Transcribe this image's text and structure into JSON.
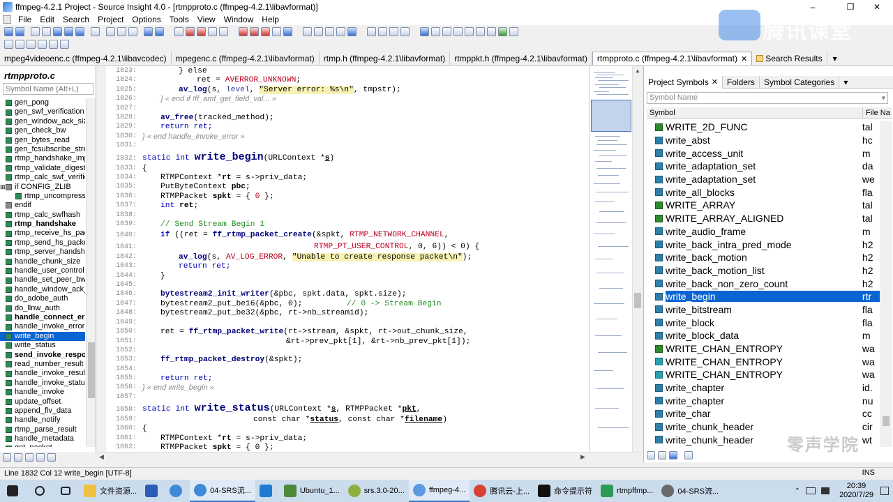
{
  "window": {
    "title": "ffmpeg-4.2.1 Project - Source Insight 4.0 - [rtmpproto.c (ffmpeg-4.2.1\\libavformat)]",
    "minimize": "–",
    "restore": "❐",
    "close": "✕"
  },
  "menu": [
    "File",
    "Edit",
    "Search",
    "Project",
    "Options",
    "Tools",
    "View",
    "Window",
    "Help"
  ],
  "file_tabs": [
    {
      "label": "mpeg4videoenc.c (ffmpeg-4.2.1\\libavcodec)"
    },
    {
      "label": "mpegenc.c (ffmpeg-4.2.1\\libavformat)"
    },
    {
      "label": "rtmp.h (ffmpeg-4.2.1\\libavformat)"
    },
    {
      "label": "rtmppkt.h (ffmpeg-4.2.1\\libavformat)"
    },
    {
      "label": "rtmpproto.c (ffmpeg-4.2.1\\libavformat)"
    },
    {
      "label": "Search Results"
    }
  ],
  "tab_close": "✕",
  "tab_dropdown": "▾",
  "left_panel": {
    "filename": "rtmpproto.c",
    "search_placeholder": "Symbol Name (Alt+L)",
    "symbols": [
      {
        "name": "gen_pong"
      },
      {
        "name": "gen_swf_verification"
      },
      {
        "name": "gen_window_ack_size"
      },
      {
        "name": "gen_check_bw"
      },
      {
        "name": "gen_bytes_read"
      },
      {
        "name": "gen_fcsubscribe_stream"
      },
      {
        "name": "rtmp_handshake_imprint"
      },
      {
        "name": "rtmp_validate_digest"
      },
      {
        "name": "rtmp_calc_swf_verification"
      },
      {
        "name": "if CONFIG_ZLIB"
      },
      {
        "name": "rtmp_uncompress_swfplayer"
      },
      {
        "name": "endif"
      },
      {
        "name": "rtmp_calc_swfhash"
      },
      {
        "name": "rtmp_handshake"
      },
      {
        "name": "rtmp_receive_hs_packet"
      },
      {
        "name": "rtmp_send_hs_packet"
      },
      {
        "name": "rtmp_server_handshake"
      },
      {
        "name": "handle_chunk_size"
      },
      {
        "name": "handle_user_control"
      },
      {
        "name": "handle_set_peer_bw"
      },
      {
        "name": "handle_window_ack_size"
      },
      {
        "name": "do_adobe_auth"
      },
      {
        "name": "do_llnw_auth"
      },
      {
        "name": "handle_connect_error"
      },
      {
        "name": "handle_invoke_error"
      },
      {
        "name": "write_begin"
      },
      {
        "name": "write_status"
      },
      {
        "name": "send_invoke_response"
      },
      {
        "name": "read_number_result"
      },
      {
        "name": "handle_invoke_result"
      },
      {
        "name": "handle_invoke_status"
      },
      {
        "name": "handle_invoke"
      },
      {
        "name": "update_offset"
      },
      {
        "name": "append_flv_data"
      },
      {
        "name": "handle_notify"
      },
      {
        "name": "rtmp_parse_result"
      },
      {
        "name": "handle_metadata"
      },
      {
        "name": "get_packet"
      }
    ]
  },
  "editor": {
    "lines": [
      {
        "n": "1823:"
      },
      {
        "n": "1824:"
      },
      {
        "n": "1825:"
      },
      {
        "n": "1826:"
      },
      {
        "n": "1827:"
      },
      {
        "n": "1828:"
      },
      {
        "n": "1829:"
      },
      {
        "n": "1830:"
      },
      {
        "n": "1831:"
      },
      {
        "n": "1832:"
      },
      {
        "n": "1833:"
      },
      {
        "n": "1834:"
      },
      {
        "n": "1835:"
      },
      {
        "n": "1836:"
      },
      {
        "n": "1837:"
      },
      {
        "n": "1838:"
      },
      {
        "n": "1839:"
      },
      {
        "n": "1840:"
      },
      {
        "n": "1841:"
      },
      {
        "n": "1842:"
      },
      {
        "n": "1843:"
      },
      {
        "n": "1844:"
      },
      {
        "n": "1845:"
      },
      {
        "n": "1846:"
      },
      {
        "n": "1847:"
      },
      {
        "n": "1848:"
      },
      {
        "n": "1849:"
      },
      {
        "n": "1850:"
      },
      {
        "n": "1851:"
      },
      {
        "n": "1852:"
      },
      {
        "n": "1853:"
      },
      {
        "n": "1854:"
      },
      {
        "n": "1855:"
      },
      {
        "n": "1856:"
      },
      {
        "n": "1857:"
      },
      {
        "n": "1858:"
      },
      {
        "n": "1859:"
      },
      {
        "n": "1860:"
      },
      {
        "n": "1861:"
      },
      {
        "n": "1862:"
      }
    ],
    "t": {
      "else": "} else",
      "ret_eq": "ret = ",
      "averror": "AVERROR_UNKNOWN",
      "semi": ";",
      "avlog": "av_log",
      "avlog_args1": "(s, ",
      "level": "level",
      "comma": ", ",
      "servererr": "\"Server error: %s\\n\"",
      "tmpstr": ", tmpstr);",
      "end_if": "} « end if !ff_amf_get_field_val... »",
      "avfree": "av_free",
      "avfree_args": "(tracked_method);",
      "return_ret": "return ret;",
      "end_hie": "} « end handle_invoke_error »",
      "static_int": "static int ",
      "write_begin": "write_begin",
      "wb_args_a": "(URLContext *",
      "s": "s",
      "close_paren": ")",
      "lbrace": "{",
      "rtmpctx": "RTMPContext *",
      "rt": "rt",
      "rt_assign": " = s->priv_data;",
      "putbyte": "PutByteContext ",
      "pbc": "pbc",
      "rtmppacket": "RTMPPacket ",
      "spkt": "spkt",
      "spkt_init_a": " = { ",
      "zero": "0",
      "spkt_init_b": " };",
      "int": "int ",
      "ret": "ret",
      "cm_send": "// Send Stream Begin 1",
      "if": "if",
      "if_a": " ((ret = ",
      "ffcreate": "ff_rtmp_packet_create",
      "create_args": "(&spkt, ",
      "netchan": "RTMP_NETWORK_CHANNEL",
      "comma_nl": ",",
      "ptuser": "RTMP_PT_USER_CONTROL",
      "args_tail": ", 0, 6)) < 0) {",
      "loglevel": "AV_LOG_ERROR",
      "unable": "\"Unable to create response packet\\n\"",
      "close_semi": ");",
      "rbrace": "}",
      "bs_init": "bytestream2_init_writer",
      "bs_init_args": "(&pbc, spkt.data, spkt.size);",
      "bs_be16": "bytestream2_put_be16",
      "bs_be16_args": "(&pbc, 0);",
      "cm_stream": "// 0 -> Stream Begin",
      "bs_be32": "bytestream2_put_be32",
      "bs_be32_args": "(&pbc, rt->nb_streamid);",
      "ffwrite": "ff_rtmp_packet_write",
      "write_args1": "(rt->stream, &spkt, rt->out_chunk_size,",
      "write_args2": "&rt->prev_pkt[1], &rt->nb_prev_pkt[1]);",
      "ffdestroy": "ff_rtmp_packet_destroy",
      "destroy_args": "(&spkt);",
      "end_wb": "} « end write_begin »",
      "write_status": "write_status",
      "ws_args_a": "(URLContext *",
      "ws_args_b": ", RTMPPacket *",
      "pkt": "pkt",
      "const_char": "const char *",
      "status": "status",
      "ws_args_c": ", const char *",
      "filename": "filename",
      "spkt_init2": " = { 0 };"
    }
  },
  "right_panel": {
    "tabs": [
      {
        "label": "Project Symbols"
      },
      {
        "label": "Folders"
      },
      {
        "label": "Symbol Categories"
      }
    ],
    "search_placeholder": "Symbol Name",
    "col_symbol": "Symbol",
    "col_file": "File Na",
    "rows": [
      {
        "name": "WRITE_2D_FUNC",
        "file": "tal"
      },
      {
        "name": "write_abst",
        "file": "hc"
      },
      {
        "name": "write_access_unit",
        "file": "m"
      },
      {
        "name": "write_adaptation_set",
        "file": "da"
      },
      {
        "name": "write_adaptation_set",
        "file": "we"
      },
      {
        "name": "write_all_blocks",
        "file": "fla"
      },
      {
        "name": "WRITE_ARRAY",
        "file": "tal"
      },
      {
        "name": "WRITE_ARRAY_ALIGNED",
        "file": "tal"
      },
      {
        "name": "write_audio_frame",
        "file": "m"
      },
      {
        "name": "write_back_intra_pred_mode",
        "file": "h2"
      },
      {
        "name": "write_back_motion",
        "file": "h2"
      },
      {
        "name": "write_back_motion_list",
        "file": "h2"
      },
      {
        "name": "write_back_non_zero_count",
        "file": "h2"
      },
      {
        "name": "write_begin",
        "file": "rtr"
      },
      {
        "name": "write_bitstream",
        "file": "fla"
      },
      {
        "name": "write_block",
        "file": "fla"
      },
      {
        "name": "write_block_data",
        "file": "m"
      },
      {
        "name": "WRITE_CHAN_ENTROPY",
        "file": "wa"
      },
      {
        "name": "WRITE_CHAN_ENTROPY",
        "file": "wa"
      },
      {
        "name": "WRITE_CHAN_ENTROPY",
        "file": "wa"
      },
      {
        "name": "write_chapter",
        "file": "id."
      },
      {
        "name": "write_chapter",
        "file": "nu"
      },
      {
        "name": "write_char",
        "file": "cc"
      },
      {
        "name": "write_chunk_header",
        "file": "cir"
      },
      {
        "name": "write_chunk_header",
        "file": "wt"
      }
    ]
  },
  "status_bar": {
    "position": "Line 1832  Col 12   write_begin [UTF-8]",
    "mode": "INS"
  },
  "taskbar": {
    "items": [
      {
        "label": "文件资源..."
      },
      {
        "label": ""
      },
      {
        "label": ""
      },
      {
        "label": "04-SRS流..."
      },
      {
        "label": ""
      },
      {
        "label": "Ubuntu_1..."
      },
      {
        "label": "srs.3.0-20..."
      },
      {
        "label": "ffmpeg-4..."
      },
      {
        "label": "腾讯云-上..."
      },
      {
        "label": "命令提示符"
      },
      {
        "label": "rtmpffmp..."
      },
      {
        "label": "04-SRS流..."
      }
    ],
    "time": "20:39",
    "date": "2020/7/29"
  },
  "watermark": {
    "top": "腾讯课堂",
    "bottom": "零声学院"
  }
}
